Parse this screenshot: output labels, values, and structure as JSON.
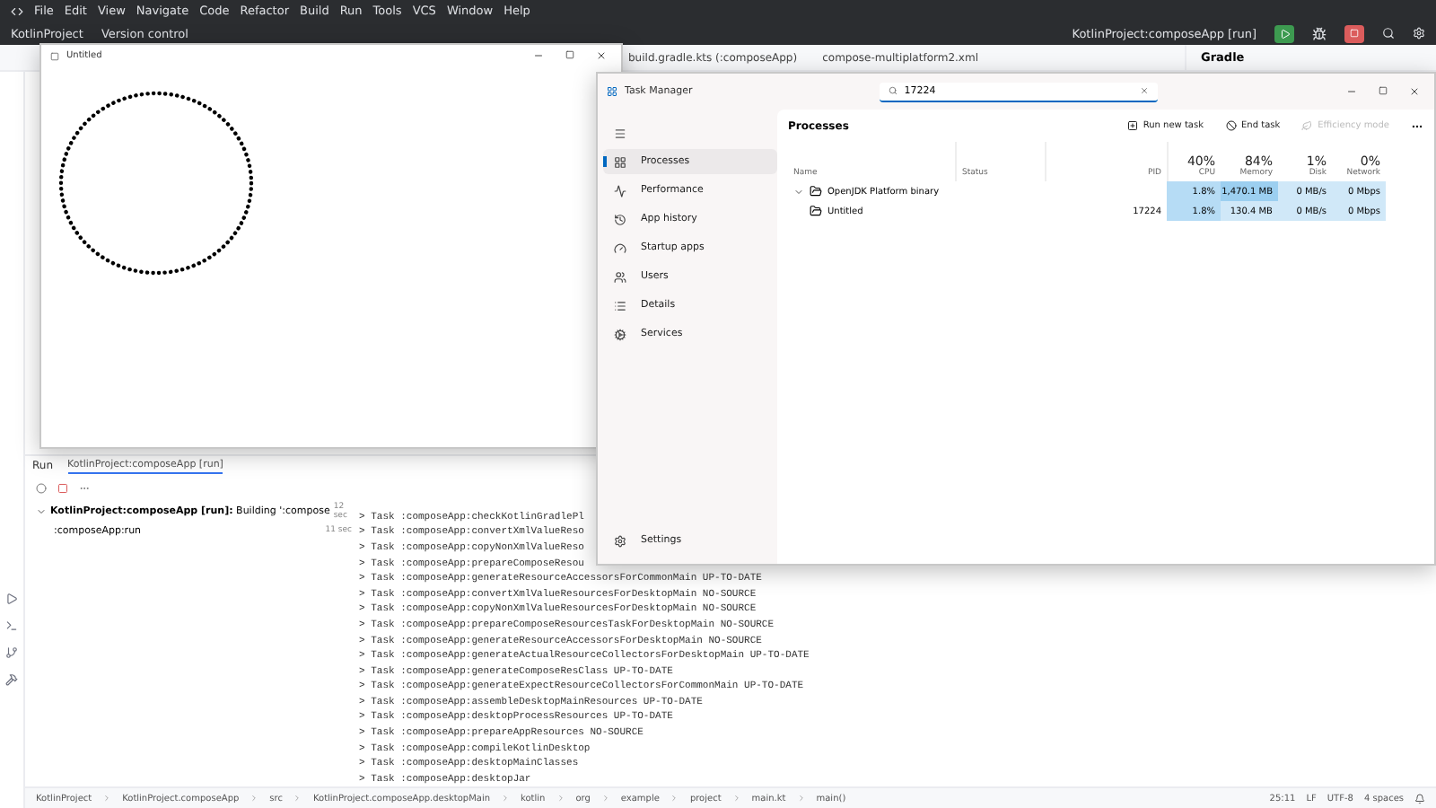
{
  "ide": {
    "menu": [
      "File",
      "Edit",
      "View",
      "Navigate",
      "Code",
      "Refactor",
      "Build",
      "Run",
      "Tools",
      "VCS",
      "Window",
      "Help"
    ],
    "project": "KotlinProject",
    "vcs": "Version control",
    "run_config": "KotlinProject:composeApp [run]",
    "editor_tabs": [
      {
        "label": "build.gradle.kts (:composeApp)",
        "selected": false
      },
      {
        "label": "compose-multiplatform2.xml",
        "selected": false
      }
    ],
    "side_panel": "Gradle",
    "run_panel": {
      "title": "Run",
      "tab": "KotlinProject:composeApp [run]",
      "tree": [
        {
          "label": "**KotlinProject:composeApp [run]:** Building ':compose",
          "time": "12 sec",
          "expanded": true,
          "children": [
            {
              "label": ":composeApp:run",
              "time": "11 sec"
            }
          ]
        }
      ],
      "log": [
        "> Task :composeApp:checkKotlinGradlePl",
        "> Task :composeApp:convertXmlValueReso",
        "> Task :composeApp:copyNonXmlValueReso",
        "> Task :composeApp:prepareComposeResou",
        "> Task :composeApp:generateResourceAccessorsForCommonMain UP-TO-DATE",
        "> Task :composeApp:convertXmlValueResourcesForDesktopMain NO-SOURCE",
        "> Task :composeApp:copyNonXmlValueResourcesForDesktopMain NO-SOURCE",
        "> Task :composeApp:prepareComposeResourcesTaskForDesktopMain NO-SOURCE",
        "> Task :composeApp:generateResourceAccessorsForDesktopMain NO-SOURCE",
        "> Task :composeApp:generateActualResourceCollectorsForDesktopMain UP-TO-DATE",
        "> Task :composeApp:generateComposeResClass UP-TO-DATE",
        "> Task :composeApp:generateExpectResourceCollectorsForCommonMain UP-TO-DATE",
        "> Task :composeApp:assembleDesktopMainResources UP-TO-DATE",
        "> Task :composeApp:desktopProcessResources UP-TO-DATE",
        "> Task :composeApp:prepareAppResources NO-SOURCE",
        "> Task :composeApp:compileKotlinDesktop",
        "> Task :composeApp:desktopMainClasses",
        "> Task :composeApp:desktopJar"
      ]
    },
    "breadcrumbs": [
      "KotlinProject",
      "KotlinProject.composeApp",
      "src",
      "KotlinProject.composeApp.desktopMain",
      "kotlin",
      "org",
      "example",
      "project",
      "main.kt",
      "main()"
    ],
    "status": [
      "25:11",
      "LF",
      "UTF-8",
      "4 spaces"
    ]
  },
  "app_window": {
    "title": "Untitled"
  },
  "task_manager": {
    "title": "Task Manager",
    "search": {
      "value": "17224"
    },
    "nav": [
      {
        "label": "Processes",
        "selected": true
      },
      {
        "label": "Performance",
        "selected": false
      },
      {
        "label": "App history",
        "selected": false
      },
      {
        "label": "Startup apps",
        "selected": false
      },
      {
        "label": "Users",
        "selected": false
      },
      {
        "label": "Details",
        "selected": false
      },
      {
        "label": "Services",
        "selected": false
      }
    ],
    "settings": "Settings",
    "heading": "Processes",
    "actions": [
      {
        "label": "Run new task",
        "disabled": false
      },
      {
        "label": "End task",
        "disabled": false
      },
      {
        "label": "Efficiency mode",
        "disabled": true
      }
    ],
    "columns": [
      {
        "label": "Name"
      },
      {
        "label": "Status"
      },
      {
        "label": "PID"
      },
      {
        "usage": "40%",
        "label": "CPU"
      },
      {
        "usage": "84%",
        "label": "Memory"
      },
      {
        "usage": "1%",
        "label": "Disk"
      },
      {
        "usage": "0%",
        "label": "Network"
      }
    ],
    "rows": [
      {
        "name": "OpenJDK Platform binary",
        "cpu": "1.8%",
        "memory": "1,470.1 MB",
        "disk": "0 MB/s",
        "network": "0 Mbps",
        "expanded": true,
        "children": [
          {
            "name": "Untitled",
            "pid": "17224",
            "cpu": "1.8%",
            "memory": "130.4 MB",
            "disk": "0 MB/s",
            "network": "0 Mbps"
          }
        ]
      }
    ]
  }
}
